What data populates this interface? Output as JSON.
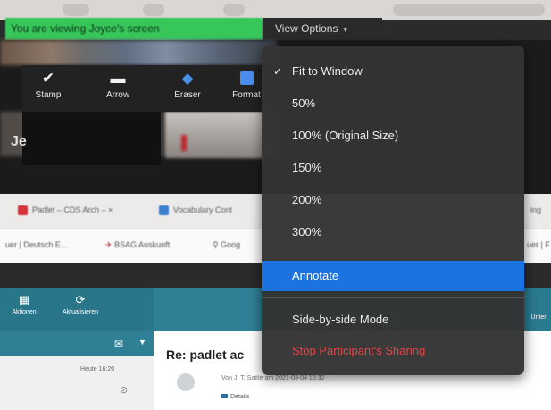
{
  "banner": {
    "viewing_text": "You are viewing Joyce's screen",
    "view_options_label": "View Options",
    "chevron": "chevron-down-icon"
  },
  "annotate_toolbar": {
    "tools": [
      {
        "label": "Stamp",
        "icon": "checkmark-icon"
      },
      {
        "label": "Arrow",
        "icon": "arrow-icon"
      },
      {
        "label": "Eraser",
        "icon": "eraser-icon"
      },
      {
        "label": "Format",
        "icon": "format-icon"
      }
    ],
    "participant_initial": "Je"
  },
  "browser": {
    "tabs": [
      {
        "label": "Padlet – CDS Arch – ×"
      },
      {
        "label": "Vocabulary Cont"
      },
      {
        "label": "ing"
      }
    ],
    "bookmarks": [
      {
        "label": "uer | Deutsch E..."
      },
      {
        "label": "BSAG Auskunft"
      },
      {
        "label": "Goog"
      },
      {
        "label": "uer | F"
      }
    ]
  },
  "mail": {
    "header_buttons": [
      {
        "label": "Aktionen",
        "icon": "grid-icon"
      },
      {
        "label": "Aktualisieren",
        "icon": "refresh-icon"
      }
    ],
    "right_label": "Unter",
    "list_time": "Heute 16:20",
    "subject": "Re: padlet ac",
    "from": "Von J. T. Sattle am 2021-03-04 15:32",
    "details_label": "Details"
  },
  "view_menu": {
    "items": [
      {
        "label": "Fit to Window",
        "checked": true
      },
      {
        "label": "50%"
      },
      {
        "label": "100% (Original Size)"
      },
      {
        "label": "150%"
      },
      {
        "label": "200%"
      },
      {
        "label": "300%"
      },
      {
        "label": "Annotate",
        "highlighted": true
      },
      {
        "label": "Side-by-side Mode"
      },
      {
        "label": "Stop Participant's Sharing",
        "danger": true
      }
    ],
    "check_glyph": "✓"
  },
  "colors": {
    "banner_green": "#37c65a",
    "menu_bg": "#343434",
    "menu_highlight": "#1a73e0",
    "danger_red": "#e0464a",
    "mail_teal": "#2f7f95"
  }
}
